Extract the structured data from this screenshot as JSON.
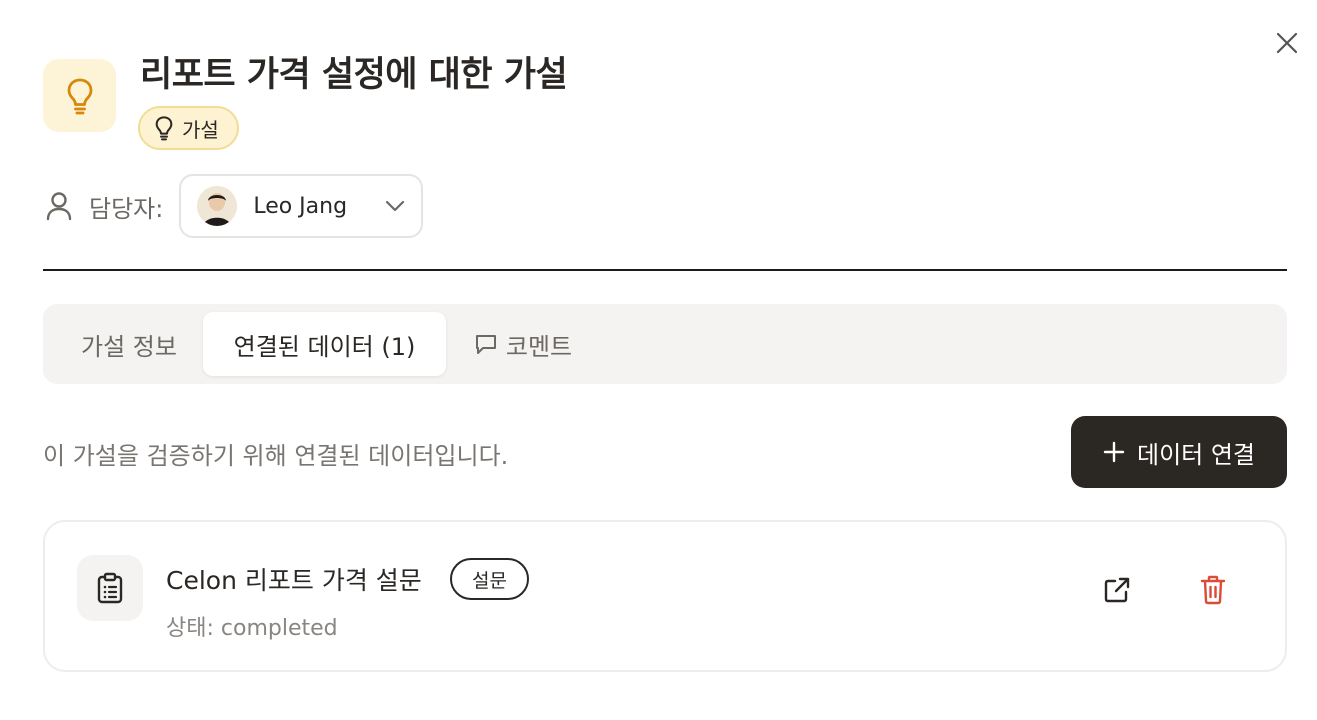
{
  "modal": {
    "title": "리포트 가격 설정에 대한 가설",
    "type_badge": "가설",
    "close_icon": "close-icon"
  },
  "assignee": {
    "label": "담당자:",
    "name": "Leo Jang"
  },
  "tabs": [
    {
      "label": "가설 정보",
      "active": false
    },
    {
      "label": "연결된 데이터 (1)",
      "active": true
    },
    {
      "label": "코멘트",
      "active": false,
      "icon": "comment-icon"
    }
  ],
  "linked_data": {
    "description": "이 가설을 검증하기 위해 연결된 데이터입니다.",
    "add_button_label": "데이터 연결",
    "items": [
      {
        "title": "Celon 리포트 가격 설문",
        "tag": "설문",
        "status": "상태: completed"
      }
    ]
  },
  "colors": {
    "accent_bulb": "#d9870a",
    "badge_bg": "#fdf3d3",
    "primary_button": "#2b2823",
    "delete": "#dc4a38"
  }
}
